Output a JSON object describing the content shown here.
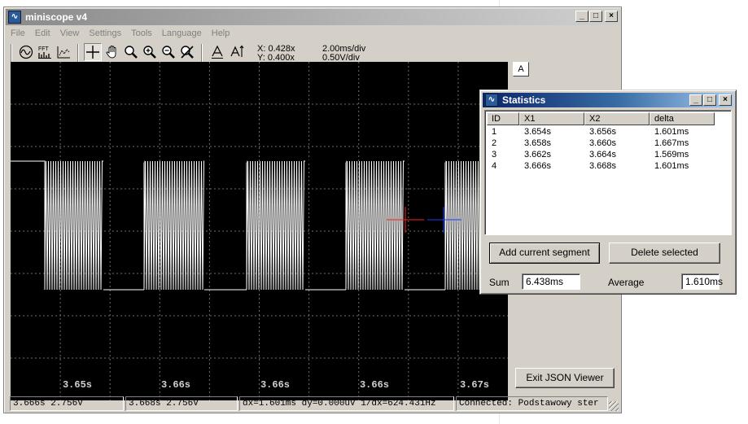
{
  "app": {
    "title": "miniscope v4"
  },
  "window_controls": {
    "minimize": "_",
    "maximize": "□",
    "close": "×"
  },
  "menu": [
    "File",
    "Edit",
    "View",
    "Settings",
    "Tools",
    "Language",
    "Help"
  ],
  "toolbar": {
    "icons": [
      "oscilloscope-icon",
      "fft-icon",
      "xy-plot-icon",
      "crosshair-cursor-icon",
      "hand-pan-icon",
      "zoom-icon",
      "zoom-in-icon",
      "zoom-out-icon",
      "zoom-reset-icon",
      "amplitude-down-icon",
      "amplitude-up-icon"
    ],
    "fft_label": "FFT",
    "cursor_x": "X: 0.428x",
    "cursor_y": "Y: 0.400x",
    "time_div": "2.00ms/div",
    "volt_div": "0.50V/div"
  },
  "scope": {
    "x_ticks": [
      "3.65s",
      "3.66s",
      "3.66s",
      "3.66s",
      "3.67s"
    ],
    "background": "#000000",
    "trace_color": "#ffffff",
    "grid_color": "#6e6e6e",
    "cursor1_color": "#ff2020",
    "cursor2_color": "#2040ff"
  },
  "side_panel": {
    "tab_label": "A",
    "exit_button": "Exit JSON Viewer"
  },
  "status": {
    "cursor1": "3.666s 2.756V",
    "cursor2": "3.668s 2.756V",
    "delta": "dx=1.601ms dy=0.000uV 1/dx=624.431Hz",
    "connection": "Connected: Podstawowy ster"
  },
  "statistics": {
    "title": "Statistics",
    "columns": [
      "ID",
      "X1",
      "X2",
      "delta"
    ],
    "rows": [
      {
        "id": "1",
        "x1": "3.654s",
        "x2": "3.656s",
        "delta": "1.601ms"
      },
      {
        "id": "2",
        "x1": "3.658s",
        "x2": "3.660s",
        "delta": "1.667ms"
      },
      {
        "id": "3",
        "x1": "3.662s",
        "x2": "3.664s",
        "delta": "1.569ms"
      },
      {
        "id": "4",
        "x1": "3.666s",
        "x2": "3.668s",
        "delta": "1.601ms"
      }
    ],
    "add_button": "Add current segment",
    "delete_button": "Delete selected",
    "sum_label": "Sum",
    "sum_value": "6.438ms",
    "average_label": "Average",
    "average_value": "1.610ms"
  }
}
